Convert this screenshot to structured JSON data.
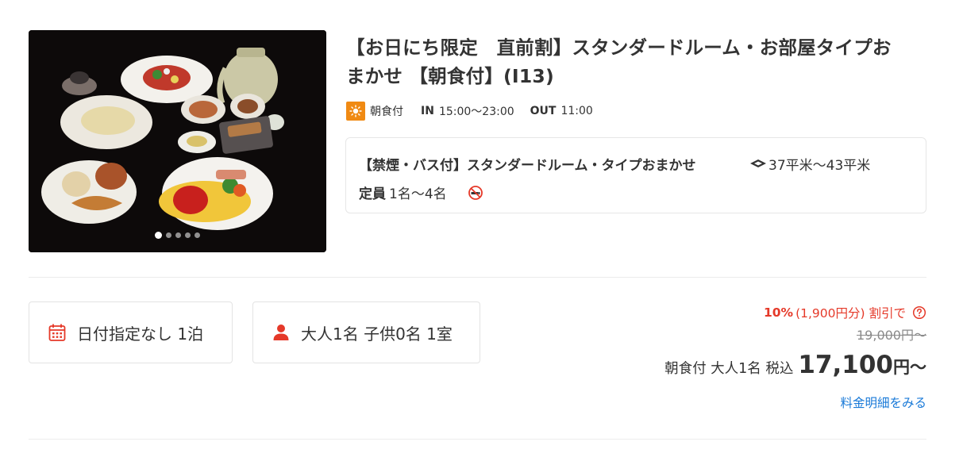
{
  "plan": {
    "title": "【お日にち限定　直前割】スタンダードルーム・お部屋タイプお\nまかせ 【朝食付】(I13)",
    "meal_label": "朝食付",
    "checkin_key": "IN",
    "checkin_time": "15:00〜23:00",
    "checkout_key": "OUT",
    "checkout_time": "11:00"
  },
  "photo": {
    "slide_count": 5,
    "active_slide": 1
  },
  "room": {
    "name": "【禁煙・バス付】スタンダードルーム・タイプおまかせ",
    "area": "37平米〜43平米",
    "capacity_label": "定員",
    "capacity_value": "1名〜4名"
  },
  "search": {
    "date_label": "日付指定なし 1泊",
    "guests_label": "大人1名 子供0名 1室"
  },
  "price": {
    "discount_pct": "10%",
    "discount_detail": "(1,900円分) 割引で",
    "original": "19,000円〜",
    "final_desc": "朝食付 大人1名 税込",
    "final_amount": "17,100",
    "final_unit": "円〜",
    "breakdown_link": "料金明細をみる"
  },
  "colors": {
    "accent_red": "#e53929",
    "meal_orange": "#f08a13",
    "link_blue": "#1a7ad8"
  },
  "icons": {
    "meal": "sun-icon",
    "area": "floor-area-icon",
    "smoking": "no-smoking-icon",
    "date": "calendar-icon",
    "guests": "person-icon",
    "help": "help-circle-icon"
  }
}
